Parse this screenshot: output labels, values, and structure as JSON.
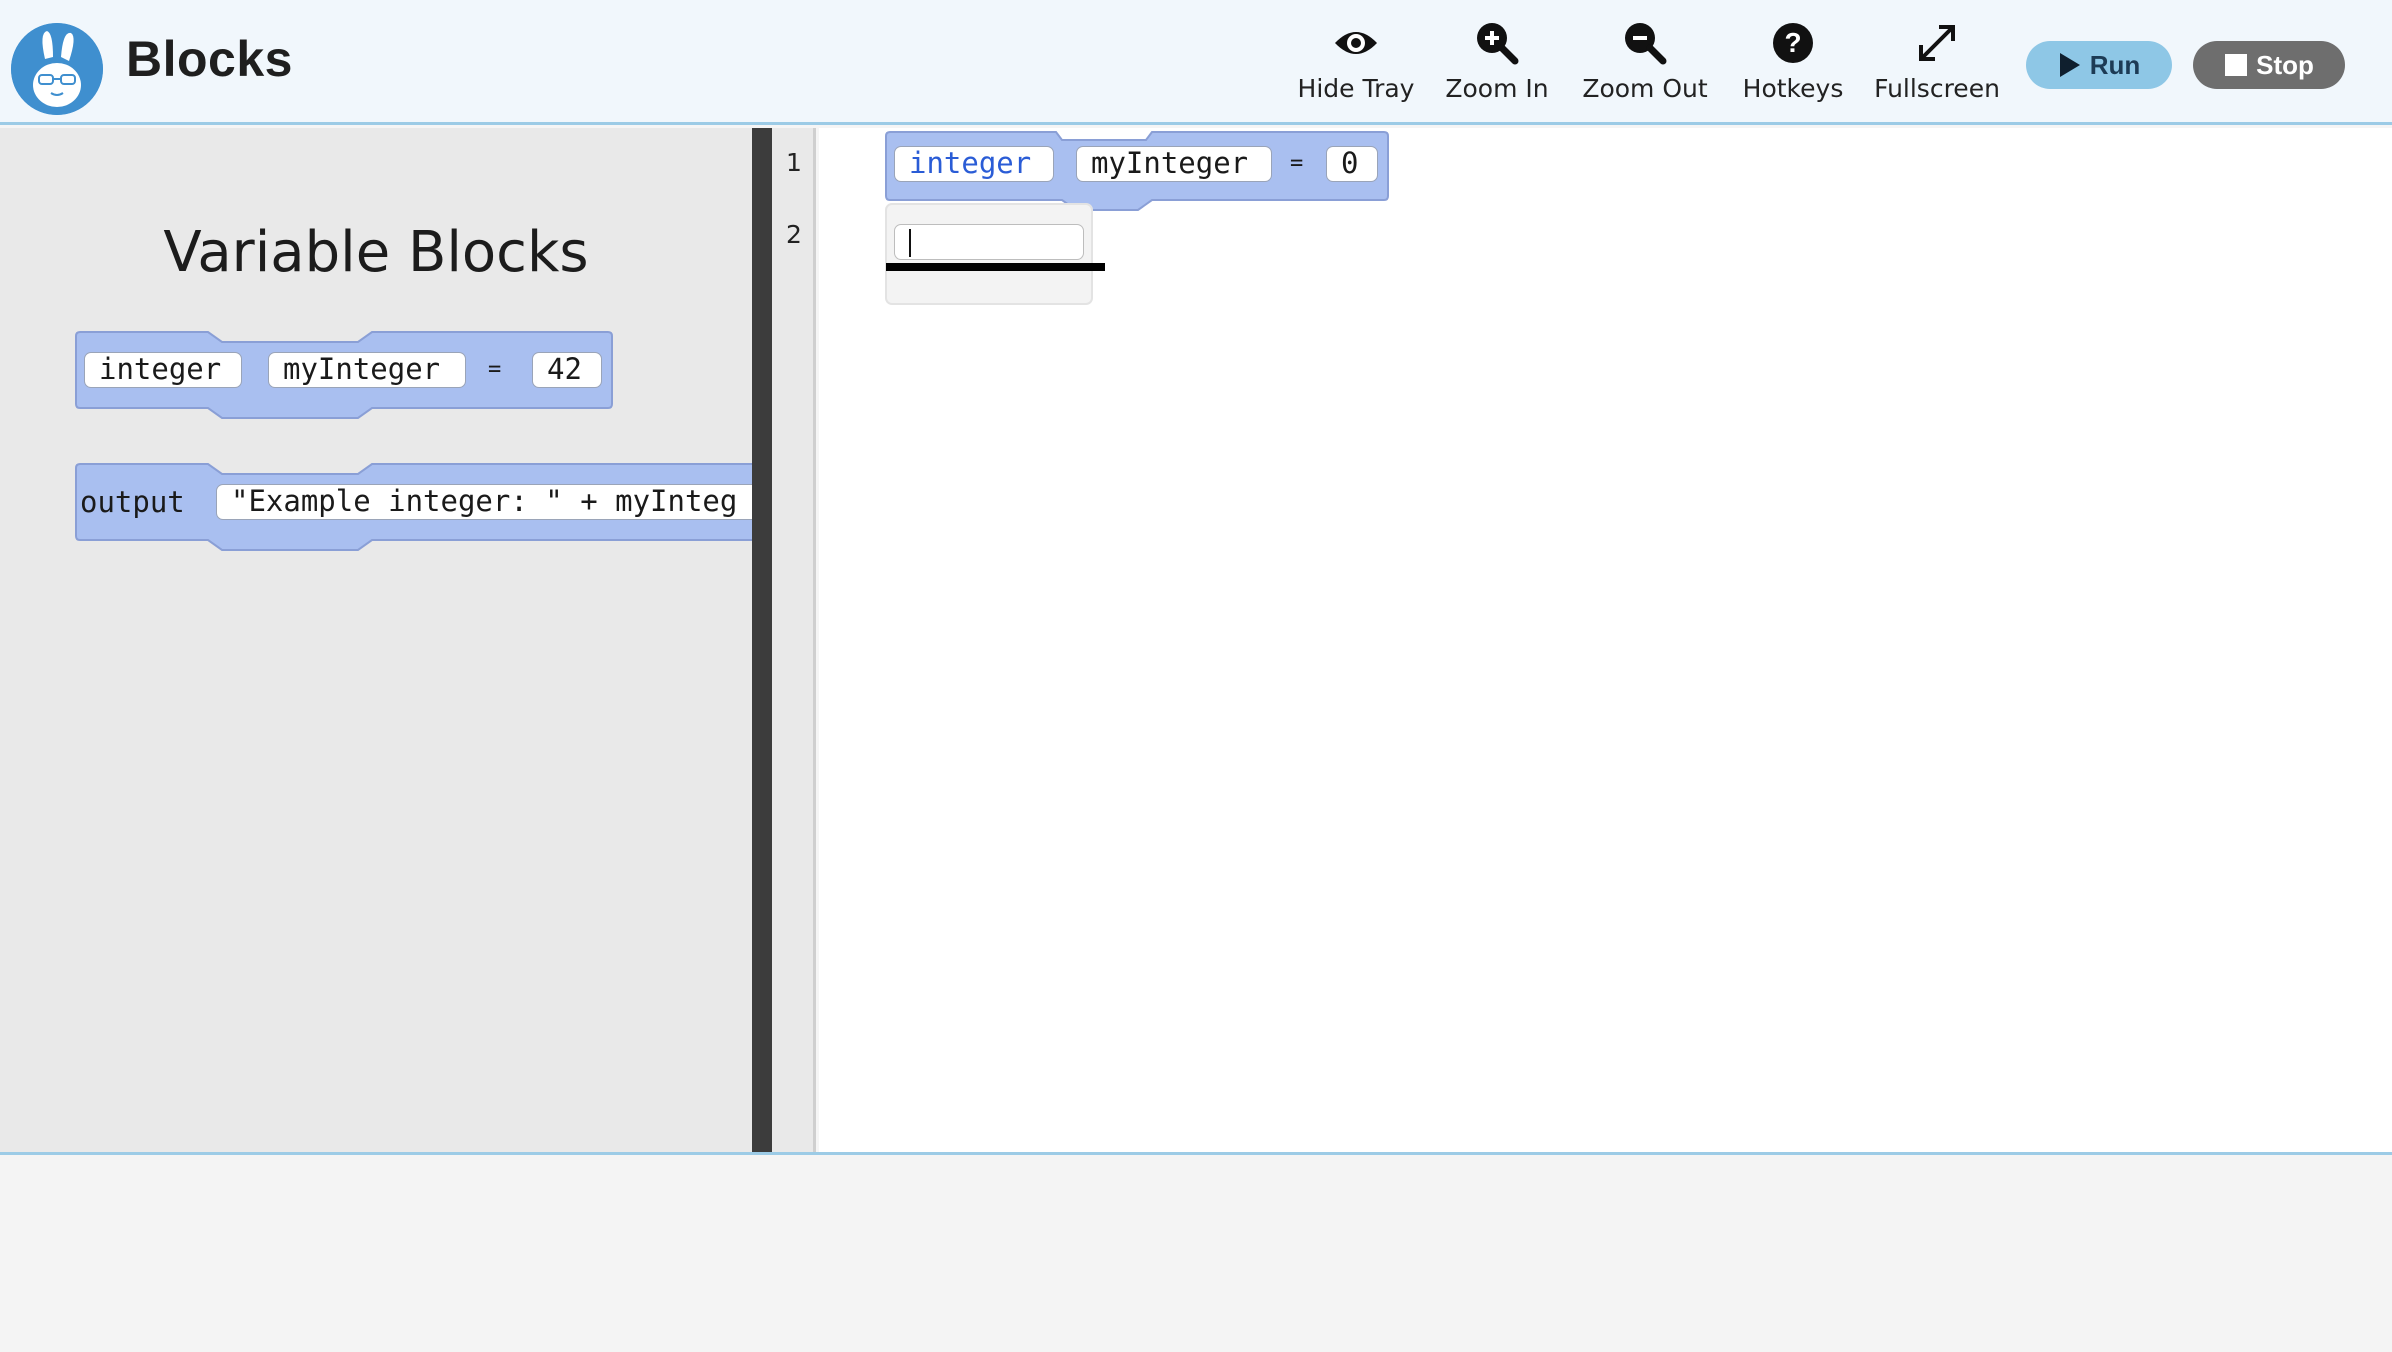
{
  "app": {
    "title": "Blocks",
    "logo_icon": "rabbit-logo-icon"
  },
  "toolbar": {
    "hide_tray": {
      "label": "Hide Tray",
      "icon": "eye-icon"
    },
    "zoom_in": {
      "label": "Zoom In",
      "icon": "zoom-in-icon"
    },
    "zoom_out": {
      "label": "Zoom Out",
      "icon": "zoom-out-icon"
    },
    "hotkeys": {
      "label": "Hotkeys",
      "icon": "question-icon"
    },
    "fullscreen": {
      "label": "Fullscreen",
      "icon": "expand-icon"
    },
    "run": {
      "label": "Run",
      "icon": "play-icon",
      "color": "#8ec7e6"
    },
    "stop": {
      "label": "Stop",
      "icon": "stop-square-icon",
      "color": "#6e6e6e"
    }
  },
  "tray": {
    "title": "Variable Blocks",
    "blocks": [
      {
        "type": "integer",
        "name": "myInteger",
        "eq": "=",
        "value": "42"
      },
      {
        "keyword": "output",
        "expression": "\"Example integer: \" + myInteg"
      }
    ]
  },
  "editor": {
    "line_numbers": [
      "1",
      "2"
    ],
    "blocks": [
      {
        "type": "integer",
        "name": "myInteger",
        "eq": "=",
        "value": "0"
      },
      {
        "input_value": ""
      }
    ]
  },
  "colors": {
    "block_fill": "#a9bff0",
    "block_stroke": "#8a9fd6",
    "header_bg": "#f1f7fc",
    "accent": "#9ccbe6"
  }
}
